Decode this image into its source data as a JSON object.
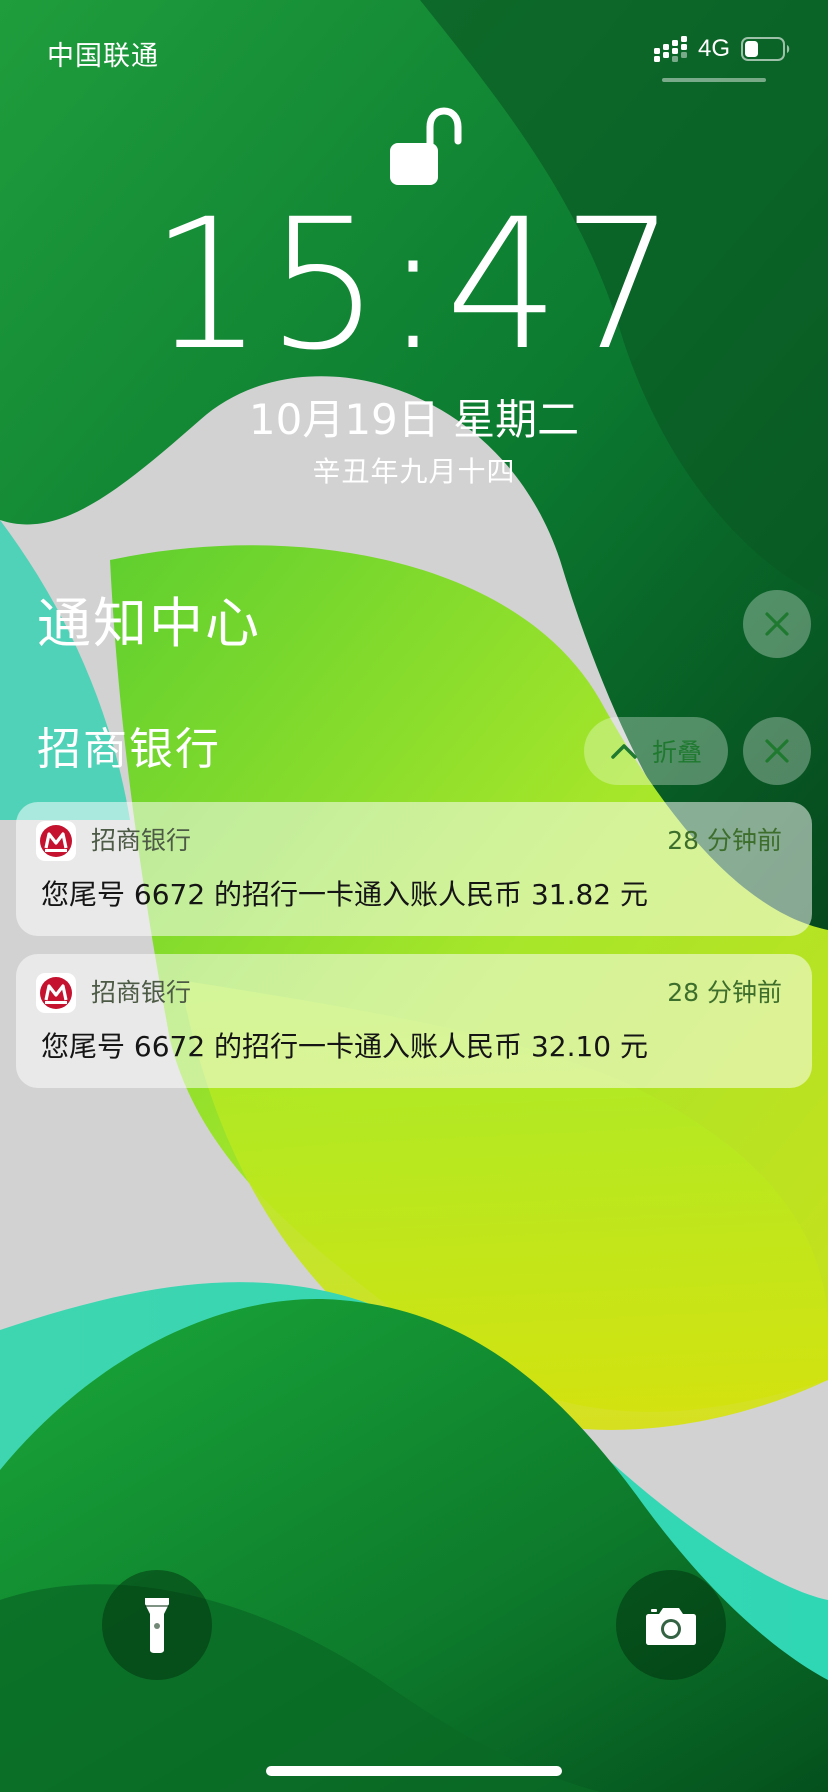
{
  "status_bar": {
    "carrier": "中国联通",
    "network": "4G",
    "battery_level": 0.35,
    "signal_icon": "signal-bars-icon",
    "battery_icon": "battery-icon"
  },
  "lock_screen": {
    "lock_icon": "unlocked-padlock-icon",
    "time": "15:47",
    "date": "10月19日 星期二",
    "lunar_date": "辛丑年九月十四"
  },
  "notification_center": {
    "title": "通知中心",
    "clear_icon": "close-icon",
    "group": {
      "title": "招商银行",
      "collapse_label": "折叠",
      "collapse_icon": "chevron-up-icon",
      "clear_icon": "close-icon",
      "notifications": [
        {
          "app": "招商银行",
          "time": "28 分钟前",
          "body": "您尾号 6672 的招行一卡通入账人民币 31.82 元"
        },
        {
          "app": "招商银行",
          "time": "28 分钟前",
          "body": "您尾号 6672 的招行一卡通入账人民币 32.10 元"
        }
      ]
    }
  },
  "bottom_controls": {
    "flashlight_icon": "flashlight-icon",
    "camera_icon": "camera-icon"
  },
  "colors": {
    "accent_green": "#1f7a2f",
    "bank_red": "#c4122f"
  }
}
